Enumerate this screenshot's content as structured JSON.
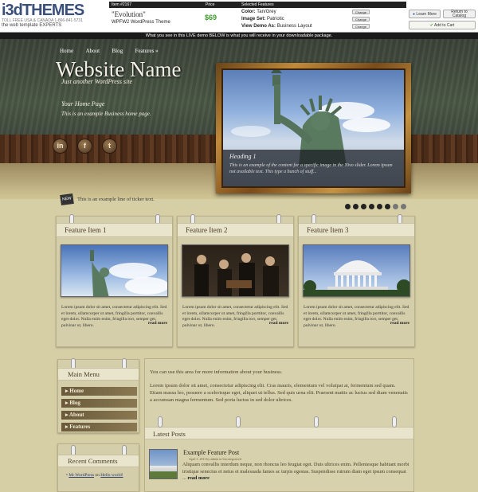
{
  "vendor": {
    "logo_main": "i3d",
    "logo_accent": "THEMES",
    "logo_phone": "TOLL FREE USA & CANADA 1-866-841-5731",
    "logo_tagline": "the web template EXPERTS",
    "item_header": "Item #2167",
    "item_name": "\"Evolution\"",
    "item_type": "WPFW2 WordPress Theme",
    "price_header": "Price",
    "price": "$69",
    "features_header": "Selected Features",
    "color_label": "Color:",
    "color_value": "Tan/Grey",
    "imageset_label": "Image Set:",
    "imageset_value": "Patriotic",
    "view_label": "View Demo As:",
    "view_value": "Business Layout",
    "change_label": "Change",
    "learn_more": "Learn More",
    "return_catalog": "Return to Catalog",
    "add_to_cart": "Add to Cart",
    "info_bar": "What you see in this LIVE demo BELOW is what you will receive in your downloadable package."
  },
  "nav": [
    "Home",
    "About",
    "Blog",
    "Features »"
  ],
  "header": {
    "site_name": "Website Name",
    "tagline": "Just another WordPress site",
    "home_page_title": "Your Home Page",
    "home_page_desc": "This is an example Business home page."
  },
  "social": [
    {
      "icon": "linkedin-icon",
      "glyph": "in"
    },
    {
      "icon": "facebook-icon",
      "glyph": "f"
    },
    {
      "icon": "twitter-icon",
      "glyph": "t"
    }
  ],
  "slider": {
    "heading": "Heading 1",
    "text": "This is an example of the content for a specific image in the Nivo slider. Lorem ipsum not available text. This type a bunch of stuff...",
    "dots_total": 8,
    "dots_active": 6
  },
  "ticker": {
    "badge": "NEW",
    "text": "This is an example line of ticker text."
  },
  "features": [
    {
      "title": "Feature Item 1",
      "text": "Lorem ipsum dolor sit amet, consectetur adipiscing elit. Sed et lorem, ullamcorper ut amet, fringilla porttitor, convallis eget dolor. Nulla enim enim, fringilla torr, semper get, pulvinar ut, libero.",
      "more": "read more"
    },
    {
      "title": "Feature Item 2",
      "text": "Lorem ipsum dolor sit amet, consectetur adipiscing elit. Sed et lorem, ullamcorper ut amet, fringilla porttitor, convallis eget dolor. Nulla enim enim, fringilla torr, semper get, pulvinar ut, libero.",
      "more": "read more"
    },
    {
      "title": "Feature Item 3",
      "text": "Lorem ipsum dolor sit amet, consectetur adipiscing elit. Sed et lorem, ullamcorper ut amet, fringilla porttitor, convallis eget dolor. Nulla enim enim, fringilla torr, semper get, pulvinar ut, libero.",
      "more": "read more"
    }
  ],
  "sidebar": {
    "menu_title": "Main Menu",
    "menu_items": [
      "Home",
      "Blog",
      "About",
      "Features"
    ],
    "recent_title": "Recent Comments",
    "recent_author": "Mr WordPress",
    "recent_on": "on",
    "recent_post": "Hello world!"
  },
  "main": {
    "intro": "You can use this area for more information about your business.",
    "para": "Lorem ipsum dolor sit amet, consectetur adipiscing elit. Cras mauris, elementum vel volutpat at, fermentum sed quam. Etiam massa leo, posuere a scelerisque eget, aliquet ut tellus. Sed quis urna elit. Praesent mattis ac luctus sed diam venenatis a accumsan magna fermentum. Sed porta luctus in sed dolor ultrices.",
    "latest_title": "Latest Posts",
    "post_title": "Example Feature Post",
    "post_meta": "April 1, 2011 by admin in Uncategorized",
    "post_body": "Aliquam convallis interdum neque, non rhoncus leo feugiat eget. Duis ultrices enim. Pellentesque habitant morbi tristique senectus et netus et malesuada fames ac turpis egestas. Suspendisse rutrum diam eget ipsum consequat ...",
    "post_more": "read more"
  }
}
